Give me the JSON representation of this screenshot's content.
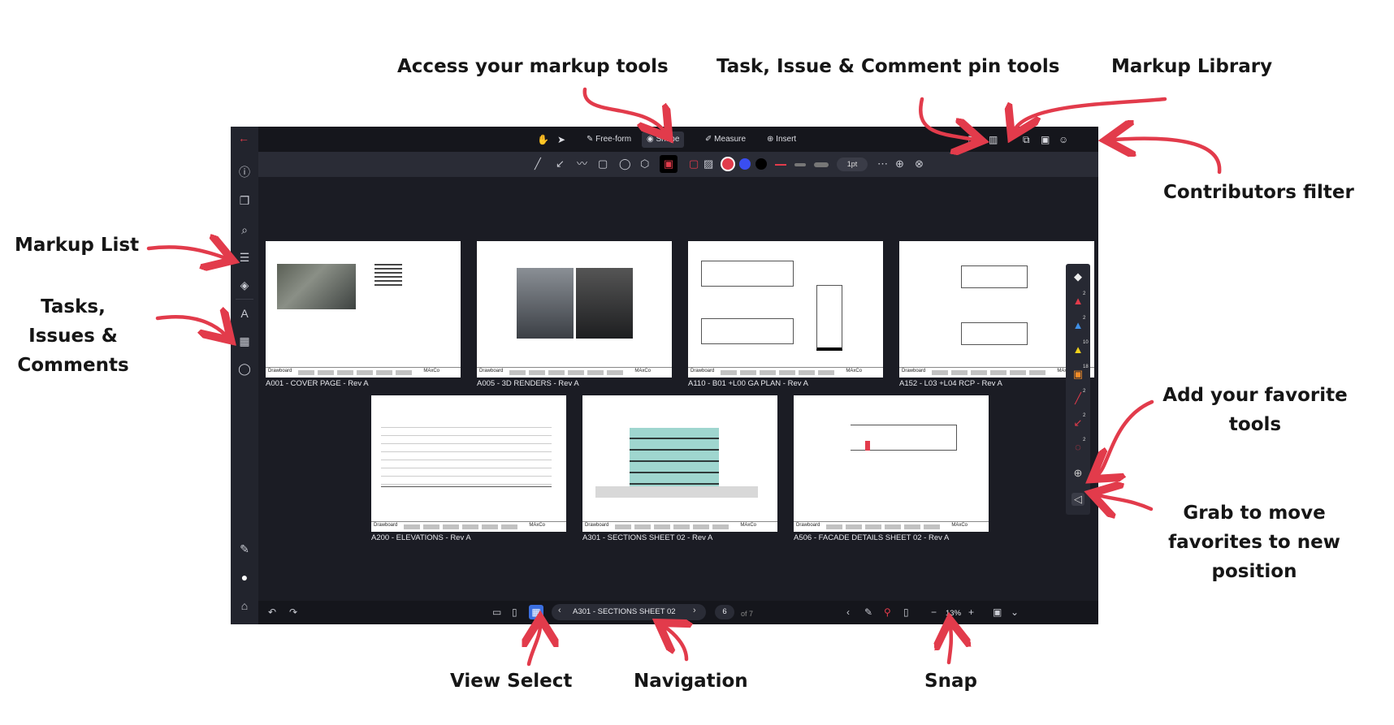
{
  "callouts": {
    "markup_tools": "Access your markup tools",
    "pin_tools": "Task, Issue & Comment pin tools",
    "markup_library": "Markup Library",
    "contributors_filter": "Contributors filter",
    "markup_list": "Markup List",
    "tasks_l1": "Tasks,",
    "tasks_l2": "Issues &",
    "tasks_l3": "Comments",
    "add_fav_l1": "Add your favorite",
    "add_fav_l2": "tools",
    "grab_l1": "Grab to move",
    "grab_l2": "favorites to new",
    "grab_l3": "position",
    "view_select": "View Select",
    "navigation": "Navigation",
    "snap": "Snap"
  },
  "toolbar": {
    "freeform": "Free-form",
    "shape": "Shape",
    "measure": "Measure",
    "insert": "Insert"
  },
  "shape_tools": {
    "line_weight": "1pt"
  },
  "sheets": [
    {
      "label": "A001 - COVER PAGE - Rev A"
    },
    {
      "label": "A005 - 3D RENDERS - Rev A"
    },
    {
      "label": "A110 - B01 +L00 GA PLAN - Rev A"
    },
    {
      "label": "A152 - L03 +L04 RCP - Rev A"
    },
    {
      "label": "A200 - ELEVATIONS - Rev A"
    },
    {
      "label": "A301 - SECTIONS SHEET 02 - Rev A"
    },
    {
      "label": "A506 - FACADE DETAILS SHEET 02 - Rev A"
    }
  ],
  "titleblock": {
    "logo": "Drawboard",
    "mark": "MAxCo"
  },
  "favorites": {
    "counts": [
      "2",
      "2",
      "10",
      "18",
      "2",
      "2",
      "2"
    ]
  },
  "navigation": {
    "current_sheet": "A301 - SECTIONS SHEET 02",
    "page": "6",
    "of": "of 7",
    "zoom": "13%"
  },
  "colors": {
    "accent": "#e23b4b",
    "app_bg": "#1b1c24",
    "active_view": "#3b6fe0"
  }
}
